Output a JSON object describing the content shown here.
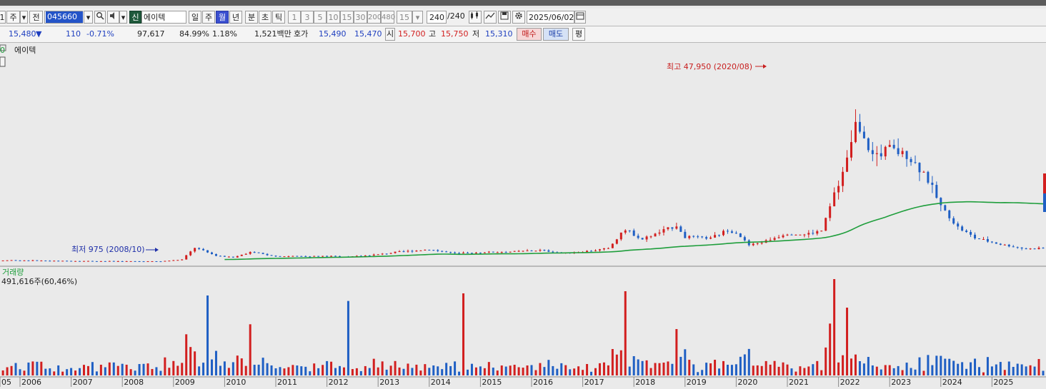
{
  "toolbar": {
    "items": [
      "1",
      "주",
      "전",
      "",
      "▼",
      "",
      "",
      "▼",
      "신",
      "에이텍",
      "",
      "일",
      "주",
      "월",
      "년",
      "분",
      "초",
      "틱",
      "1",
      "3",
      "5",
      "10",
      "15",
      "30",
      "200",
      "480",
      "15",
      "▼",
      "240",
      "/240",
      "",
      "",
      "",
      "",
      "2025/06/02",
      ""
    ],
    "stock_code": "045660",
    "stock_name": "에이텍",
    "period_selected": "월",
    "count": "240",
    "count_total": "/240",
    "date": "2025/06/02",
    "market_badge": "신"
  },
  "quote": {
    "price": "15,480",
    "change_arrow": "▼",
    "change": "110",
    "change_pct": "-0.71%",
    "volume": "97,617",
    "ratio": "84.99%",
    "turnover_pct": "1.18%",
    "amount": "1,521백만",
    "bid_label": "호가",
    "bid1": "15,490",
    "bid2": "15,470",
    "open_label": "시",
    "open": "15,700",
    "high_label": "고",
    "high": "15,750",
    "low_label": "저",
    "low": "15,310",
    "buy_button": "매수",
    "sell_button": "매도",
    "avg_button": "평"
  },
  "colors": {
    "up": "#d21f1f",
    "down": "#1f5fc4",
    "ma": "#1f9e3c",
    "annotation_high": "#c81e1e",
    "annotation_low": "#1f2fa8"
  },
  "chart_data": [
    {
      "type": "candlestick",
      "panel": "price",
      "legend_prefix": "0",
      "legend_name": "에이텍",
      "x_labels": [
        "05",
        "2006",
        "2007",
        "2008",
        "2009",
        "2010",
        "2011",
        "2012",
        "2013",
        "2014",
        "2015",
        "2016",
        "2017",
        "2018",
        "2019",
        "2020",
        "2021",
        "2022",
        "2023",
        "2024",
        "2025"
      ],
      "annotations": [
        {
          "label": "최고 47,950 (2020/08)",
          "kind": "high",
          "value": 47950,
          "date": "2020-08"
        },
        {
          "label": "최저 975 (2008/10)",
          "kind": "low",
          "value": 975,
          "date": "2008-10"
        }
      ],
      "series_points_shown": "monthly OHLC 2005–2025 (approximate)"
    },
    {
      "type": "bar",
      "panel": "volume",
      "title": "거래량",
      "value_text": "491,616주(60,46%)"
    }
  ]
}
